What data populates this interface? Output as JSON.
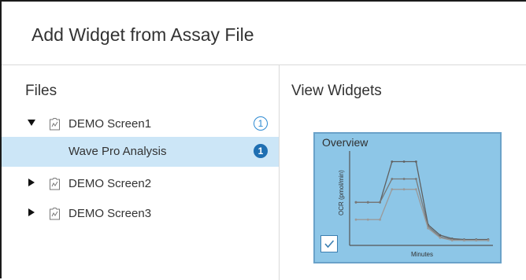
{
  "dialog": {
    "title": "Add Widget from Assay File"
  },
  "files": {
    "heading": "Files",
    "items": [
      {
        "label": "DEMO Screen1",
        "expanded": true,
        "badge": "1",
        "badge_style": "outline"
      },
      {
        "label": "Wave Pro Analysis",
        "child": true,
        "selected": true,
        "badge": "1",
        "badge_style": "filled"
      },
      {
        "label": "DEMO Screen2",
        "expanded": false
      },
      {
        "label": "DEMO Screen3",
        "expanded": false
      }
    ]
  },
  "widgets": {
    "heading": "View Widgets",
    "card": {
      "title": "Overview",
      "checked": true,
      "chart_data": {
        "type": "line",
        "title": "Overview",
        "xlabel": "Minutes",
        "ylabel": "OCR (pmol/min)",
        "x": [
          0,
          1,
          2,
          3,
          4,
          5,
          6,
          7,
          8,
          9,
          10,
          11
        ],
        "ylim": [
          0,
          100
        ],
        "series": [
          {
            "values": [
              48,
              48,
              48,
              95,
              95,
              95,
              22,
              10,
              6,
              5,
              5,
              5
            ]
          },
          {
            "values": [
              48,
              48,
              48,
              75,
              75,
              75,
              20,
              8,
              5,
              4,
              4,
              4
            ]
          },
          {
            "values": [
              28,
              28,
              28,
              63,
              63,
              63,
              18,
              7,
              4,
              4,
              4,
              4
            ]
          }
        ],
        "colors": [
          "#5f5f5f",
          "#777777",
          "#9a9a9a"
        ],
        "grid": false
      }
    }
  },
  "colors": {
    "selected_row": "#cce6f7",
    "badge_blue": "#2d8ad2",
    "card_fill": "#8dc6e7",
    "card_border": "#6aa2c9"
  }
}
